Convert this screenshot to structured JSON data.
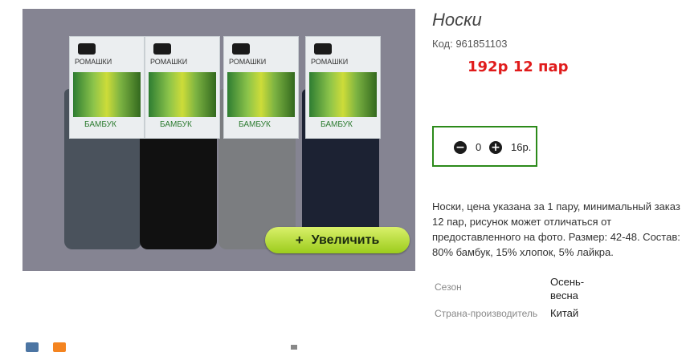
{
  "product": {
    "title": "Носки",
    "code": "Код: 961851103",
    "price": "192р 12 пар"
  },
  "image": {
    "zoom_label": "Увеличить",
    "zoom_icon": "plus-icon",
    "packs": [
      {
        "brand": "РОМАШКИ",
        "label": "БАМБУК",
        "sock_color": "#4a525c"
      },
      {
        "brand": "РОМАШКИ",
        "label": "БАМБУК",
        "sock_color": "#111111"
      },
      {
        "brand": "РОМАШКИ",
        "label": "БАМБУК",
        "sock_color": "#7b7d80"
      },
      {
        "brand": "РОМАШКИ",
        "label": "БАМБУК",
        "sock_color": "#1c2233"
      }
    ]
  },
  "quantity": {
    "value": "0",
    "unit_price": "16р.",
    "minus_icon": "minus-circle-icon",
    "plus_icon": "plus-circle-icon"
  },
  "description": "Носки, цена указана за 1 пару, минимальный заказ 12 пар, рисунок может отличаться от предоставленного на фото. Размер: 42-48. Состав: 80% бамбук, 15% хлопок, 5% лайкра.",
  "properties": [
    {
      "name": "Сезон",
      "value": "Осень-весна"
    },
    {
      "name": "Страна-производитель",
      "value": "Китай"
    }
  ],
  "colors": {
    "price": "#e01b1b",
    "qty_border": "#2c8a1a",
    "zoom_button": "#b5dd33"
  }
}
